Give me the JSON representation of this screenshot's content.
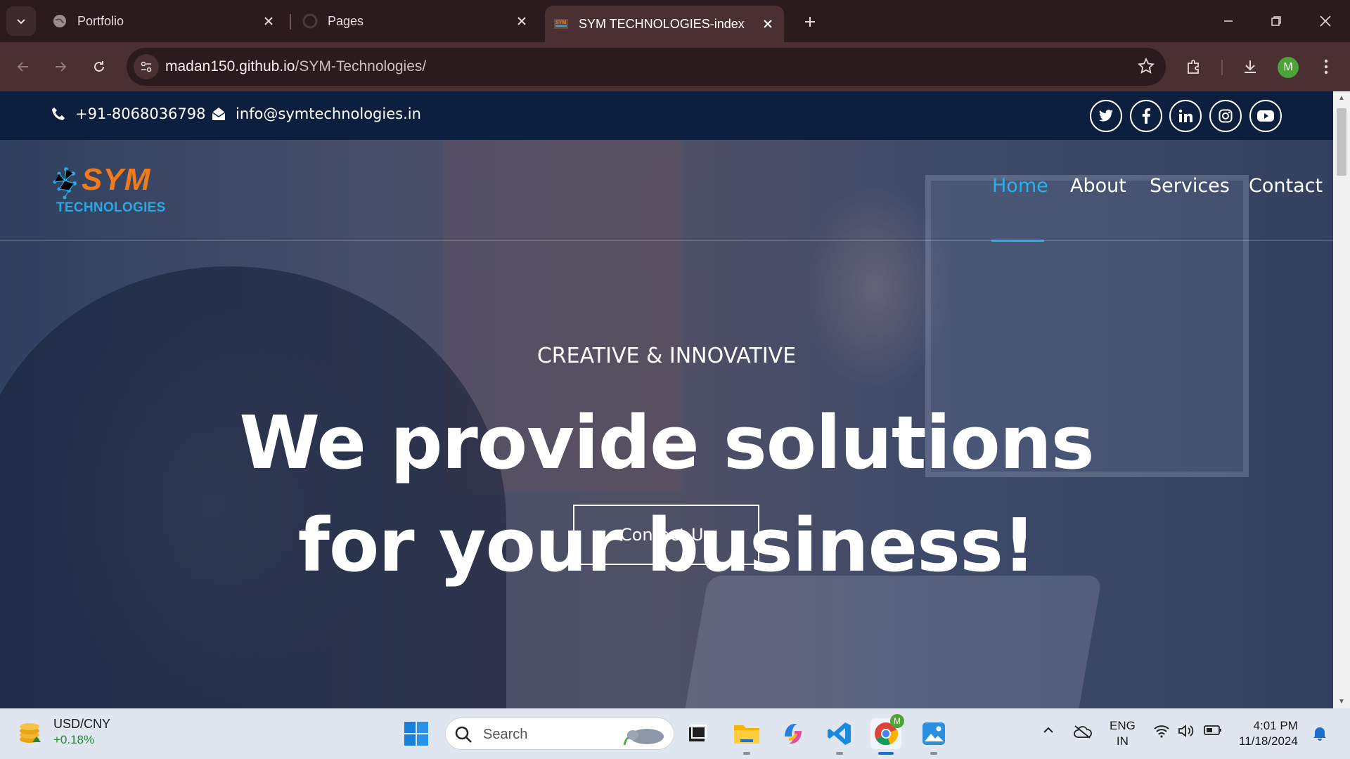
{
  "browser": {
    "tabs": [
      {
        "title": "Portfolio"
      },
      {
        "title": "Pages"
      },
      {
        "title": "SYM TECHNOLOGIES-index"
      }
    ],
    "url_host": "madan150.github.io",
    "url_path": "/SYM-Technologies/",
    "profile_initial": "M"
  },
  "topbar": {
    "phone": "+91-8068036798",
    "email": "info@symtechnologies.in",
    "social": [
      {
        "name": "twitter-icon"
      },
      {
        "name": "facebook-icon"
      },
      {
        "name": "linkedin-icon"
      },
      {
        "name": "instagram-icon"
      },
      {
        "name": "youtube-icon"
      }
    ]
  },
  "header": {
    "logo_main": "SYM",
    "logo_sub": "TECHNOLOGIES",
    "nav": [
      "Home",
      "About",
      "Services",
      "Contact"
    ],
    "active_nav": "Home"
  },
  "hero": {
    "subtitle": "CREATIVE & INNOVATIVE",
    "title_line1": "We provide solutions",
    "title_line2": "for your business!",
    "cta": "Contact Us"
  },
  "taskbar": {
    "widget_title": "USD/CNY",
    "widget_value": "+0.18%",
    "search_placeholder": "Search",
    "lang_line1": "ENG",
    "lang_line2": "IN",
    "time": "4:01 PM",
    "date": "11/18/2024",
    "chrome_badge": "M"
  },
  "colors": {
    "accent": "#2ab1ec",
    "topbar_bg": "#0d1f3f",
    "logo_orange": "#f07a1c",
    "logo_blue": "#2aa8e0",
    "browser_frame": "#4a2f33"
  }
}
